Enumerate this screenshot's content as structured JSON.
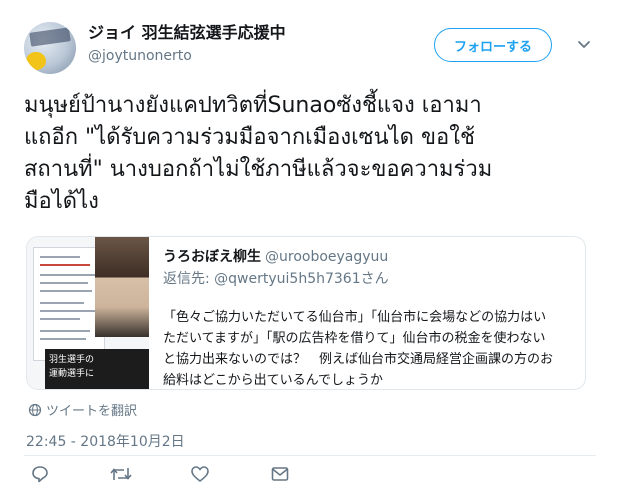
{
  "header": {
    "display_name": "ジョイ 羽生結弦選手応援中",
    "handle": "@joytunonerto",
    "follow_label": "フォローする"
  },
  "tweet": {
    "text": "มนุษย์ป้านางยังแคปทวิตที่Sunaoซังชี้แจง เอามา\nแถอีก \"ได้รับความร่วมมือจากเมืองเซนได ขอใช้\nสถานที่\" นางบอกถ้าไม่ใช้ภาษีแล้วจะขอความร่วม\nมือได้ไง"
  },
  "quote": {
    "name": "うろおぼえ柳生",
    "handle": "@urooboeyagyuu",
    "reply_prefix": "返信先:",
    "reply_to": "@qwertyui5h5h7361さん",
    "text": "「色々ご協力いただいてる仙台市」「仙台市に会場などの協力はい\nただいてますが」「駅の広告枠を借りて」仙台市の税金を使わない\nと協力出来ないのでは？　例えば仙台市交通局経営企画課の方のお\n給料はどこから出ているんでしょうか",
    "media_banner": [
      "羽生選手の",
      "運動選手に"
    ]
  },
  "retweet_label": "ツイートを翻訳",
  "timestamp": "22:45 - 2018年10月2日",
  "colors": {
    "accent": "#1da1f2",
    "muted": "#657786",
    "border": "#e1e8ed"
  },
  "icons": [
    "reply-icon",
    "retweet-icon",
    "like-icon",
    "message-icon",
    "globe-icon",
    "chevron-down-icon"
  ]
}
